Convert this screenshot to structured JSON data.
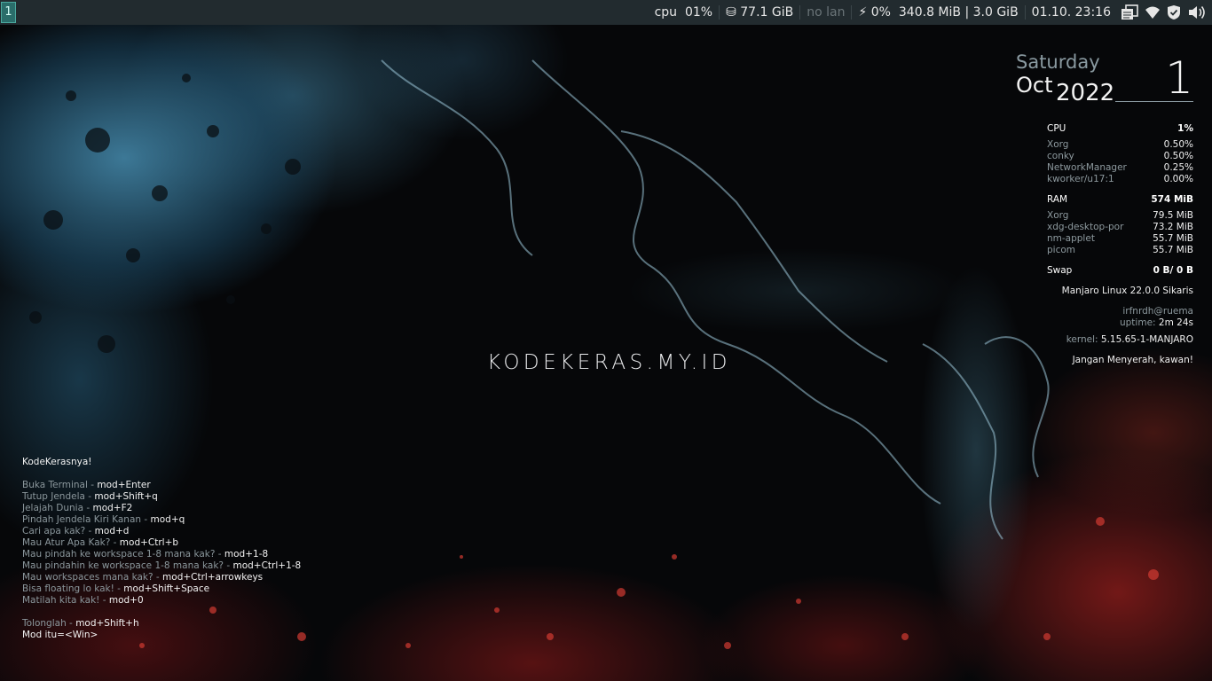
{
  "wallpaper": {
    "brand_text": "KODEKERAS.MY.ID"
  },
  "topbar": {
    "workspace": "1",
    "cpu_label": "cpu",
    "cpu_value": "01%",
    "disk_icon": "⛁",
    "disk_value": "77.1 GiB",
    "lan": "no lan",
    "battery_icon": "⚡",
    "battery_value": "0%",
    "memory": "340.8 MiB | 3.0 GiB",
    "datetime": "01.10. 23:16",
    "tray_icons": [
      "clipboard-icon",
      "wifi-icon",
      "shield-check-icon",
      "volume-icon"
    ]
  },
  "conky": {
    "date": {
      "day": "Saturday",
      "month": "Oct",
      "year": "2022",
      "day_number": "1"
    },
    "cpu": {
      "label": "CPU",
      "value": "1%",
      "processes": [
        {
          "name": "Xorg",
          "value": "0.50%"
        },
        {
          "name": "conky",
          "value": "0.50%"
        },
        {
          "name": "NetworkManager",
          "value": "0.25%"
        },
        {
          "name": "kworker/u17:1",
          "value": "0.00%"
        }
      ]
    },
    "ram": {
      "label": "RAM",
      "value": "574 MiB",
      "processes": [
        {
          "name": "Xorg",
          "value": "79.5 MiB"
        },
        {
          "name": "xdg-desktop-por",
          "value": "73.2 MiB"
        },
        {
          "name": "nm-applet",
          "value": "55.7 MiB"
        },
        {
          "name": "picom",
          "value": "55.7 MiB"
        }
      ]
    },
    "swap": {
      "label": "Swap",
      "value": "0 B/ 0 B"
    },
    "os": "Manjaro Linux 22.0.0 Sikaris",
    "user": "irfnrdh@ruema",
    "uptime_label": "uptime:",
    "uptime": "2m 24s",
    "kernel_label": "kernel:",
    "kernel": "5.15.65-1-MANJARO",
    "motto": "Jangan Menyerah, kawan!"
  },
  "cheatsheet": {
    "title": "KodeKerasnya!",
    "items": [
      {
        "desc": "Buka Terminal - ",
        "keys": "mod+Enter"
      },
      {
        "desc": "Tutup Jendela - ",
        "keys": "mod+Shift+q"
      },
      {
        "desc": "Jelajah Dunia - ",
        "keys": "mod+F2"
      },
      {
        "desc": "Pindah Jendela Kiri Kanan - ",
        "keys": "mod+q"
      },
      {
        "desc": "Cari apa kak? - ",
        "keys": "mod+d"
      },
      {
        "desc": "Mau Atur Apa Kak? - ",
        "keys": "mod+Ctrl+b"
      },
      {
        "desc": "Mau pindah ke workspace 1-8 mana kak? - ",
        "keys": "mod+1-8"
      },
      {
        "desc": "Mau pindahin ke workspace 1-8 mana kak? - ",
        "keys": "mod+Ctrl+1-8"
      },
      {
        "desc": "Mau workspaces mana kak? - ",
        "keys": "mod+Ctrl+arrowkeys"
      },
      {
        "desc": "Bisa floating lo kak! - ",
        "keys": "mod+Shift+Space"
      },
      {
        "desc": "Matilah kita kak! - ",
        "keys": "mod+0"
      }
    ],
    "help": {
      "desc": "Tolonglah - ",
      "keys": "mod+Shift+h"
    },
    "mod_note": "Mod itu=<Win>"
  }
}
